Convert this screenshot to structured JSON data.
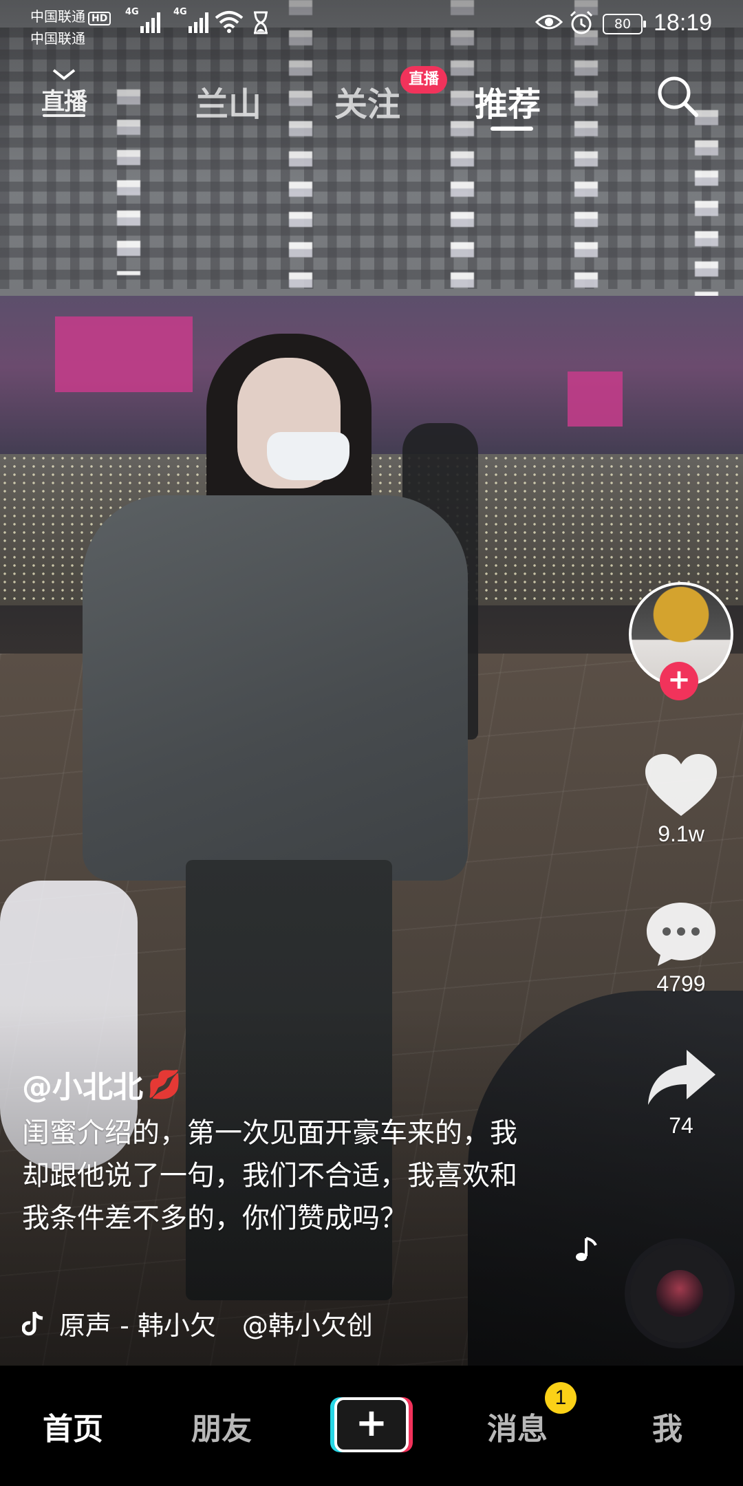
{
  "status_bar": {
    "carrier_primary": "中国联通",
    "carrier_primary_badge": "HD",
    "carrier_secondary": "中国联通",
    "network_1": "4G",
    "network_2": "4G",
    "battery": "80",
    "time": "18:19"
  },
  "top_nav": {
    "live_label": "直播",
    "tabs": [
      {
        "label": "兰山",
        "active": false
      },
      {
        "label": "关注",
        "active": false,
        "badge": "直播"
      },
      {
        "label": "推荐",
        "active": true
      }
    ]
  },
  "actions": {
    "follow": "+",
    "likes": "9.1w",
    "comments": "4799",
    "shares": "74"
  },
  "post": {
    "author": "@小北北",
    "author_emoji": "💋",
    "caption": "闺蜜介绍的，第一次见面开豪车来的，我却跟他说了一句，我们不合适，我喜欢和我条件差不多的，你们赞成吗？",
    "music_text": "原声 - 韩小欠　@韩小欠创"
  },
  "bottom_nav": {
    "home": "首页",
    "friends": "朋友",
    "create": "+",
    "messages": "消息",
    "messages_badge": "1",
    "me": "我"
  },
  "colors": {
    "accent_red": "#f1335b",
    "accent_cyan": "#27d7e6",
    "badge_yellow": "#fbd117"
  }
}
